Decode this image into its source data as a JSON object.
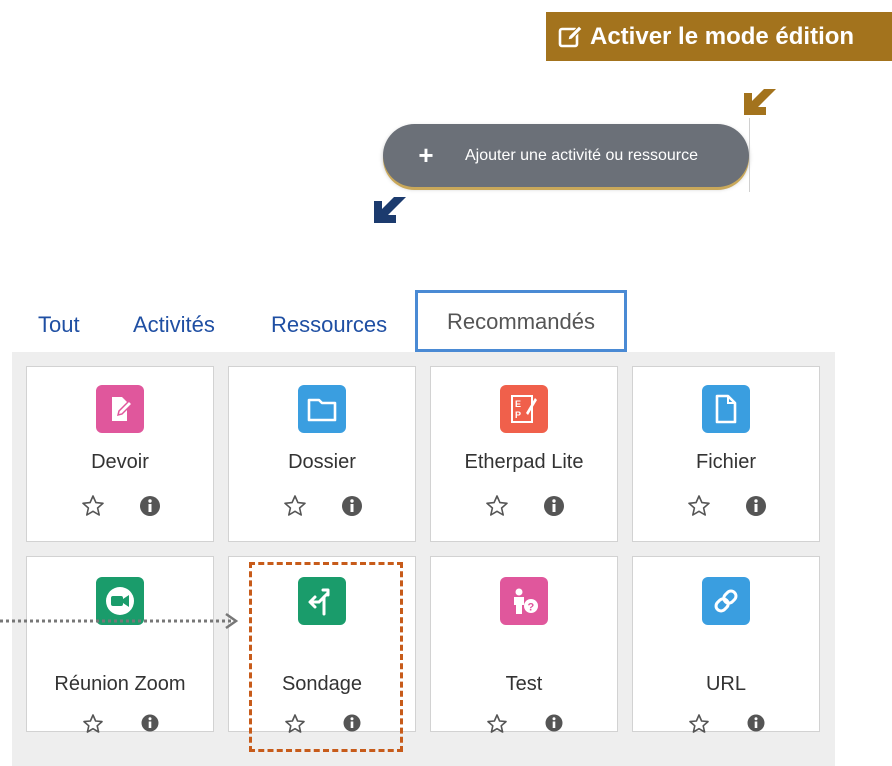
{
  "header": {
    "edit_mode_label": "Activer le mode édition",
    "edit_icon": "edit-icon",
    "accent_color": "#a3731d"
  },
  "add_activity": {
    "label": "Ajouter une activité ou ressource",
    "icon": "plus-icon"
  },
  "tabs": [
    {
      "label": "Tout",
      "active": false
    },
    {
      "label": "Activités",
      "active": false
    },
    {
      "label": "Ressources",
      "active": false
    },
    {
      "label": "Recommandés",
      "active": true
    }
  ],
  "modules": [
    {
      "label": "Devoir",
      "icon": "assignment-icon",
      "color": "#e0579c"
    },
    {
      "label": "Dossier",
      "icon": "folder-icon",
      "color": "#3a9ee0"
    },
    {
      "label": "Etherpad Lite",
      "icon": "etherpad-icon",
      "color": "#f0604b"
    },
    {
      "label": "Fichier",
      "icon": "file-icon",
      "color": "#3a9ee0"
    },
    {
      "label": "Réunion Zoom",
      "icon": "zoom-video-icon",
      "color": "#1a9c6b"
    },
    {
      "label": "Sondage",
      "icon": "choice-icon",
      "color": "#1a9c6b"
    },
    {
      "label": "Test",
      "icon": "quiz-icon",
      "color": "#e0579c"
    },
    {
      "label": "URL",
      "icon": "link-icon",
      "color": "#3a9ee0"
    }
  ]
}
